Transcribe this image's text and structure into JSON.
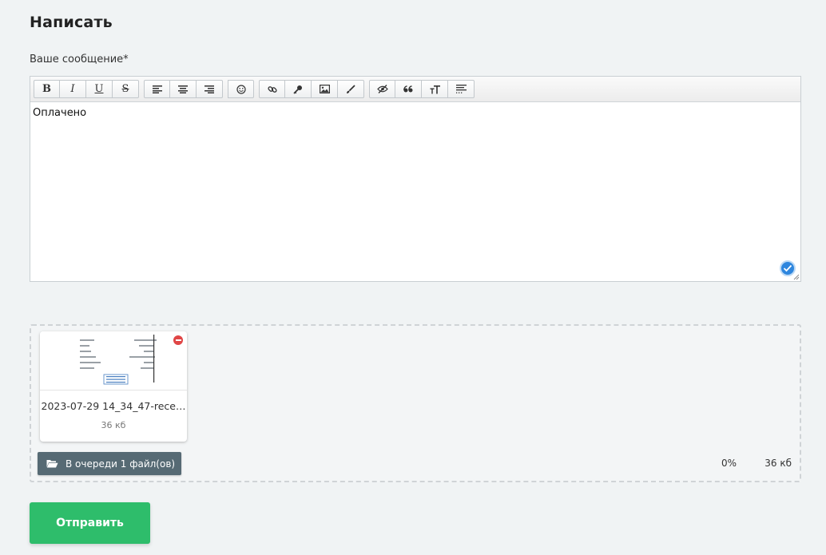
{
  "page": {
    "title": "Написать"
  },
  "form": {
    "message_label": "Ваше сообщение*",
    "message_value": "Оплачено"
  },
  "toolbar": {
    "groups": [
      [
        "bold-icon",
        "italic-icon",
        "underline-icon",
        "strikethrough-icon"
      ],
      [
        "align-left-icon",
        "align-center-icon",
        "align-right-icon"
      ],
      [
        "smiley-icon"
      ],
      [
        "link-icon",
        "key-icon",
        "image-icon",
        "brush-icon"
      ],
      [
        "hide-icon",
        "quote-icon",
        "font-size-icon",
        "text-more-icon"
      ]
    ],
    "bold_label": "B",
    "italic_label": "I",
    "underline_label": "U",
    "strike_label": "S"
  },
  "attachments": {
    "files": [
      {
        "name": "2023-07-29 14_34_47-rece…",
        "size": "36 кб"
      }
    ],
    "queue_label": "В очереди 1 файл(ов)",
    "progress": "0%",
    "total_size": "36 кб"
  },
  "actions": {
    "submit_label": "Отправить"
  },
  "colors": {
    "submit": "#2ebd6b",
    "queue": "#566a74",
    "remove": "#e04646",
    "check": "#2e86de"
  }
}
